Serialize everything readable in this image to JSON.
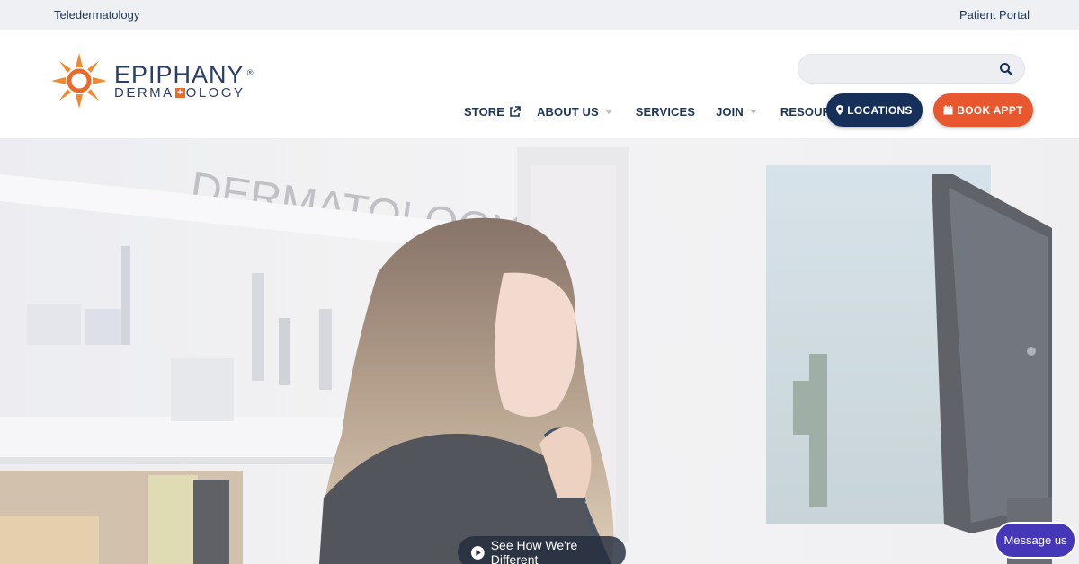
{
  "topbar": {
    "left_link": "Teledermatology",
    "right_link": "Patient Portal"
  },
  "logo": {
    "name": "EPIPHANY",
    "registered": "®",
    "sub_left": "DERMA",
    "sub_right": "OLOGY"
  },
  "search": {
    "placeholder": ""
  },
  "nav": {
    "items": [
      {
        "label": "STORE",
        "icon": "external-link-icon"
      },
      {
        "label": "ABOUT US",
        "dropdown": true
      },
      {
        "label": "SERVICES"
      },
      {
        "label": "JOIN",
        "dropdown": true
      },
      {
        "label": "RESOURCES",
        "dropdown": true
      }
    ],
    "locations_label": "LOCATIONS",
    "book_label": "BOOK APPT"
  },
  "hero": {
    "video_label": "See How We're Different"
  },
  "chat": {
    "label": "Message us"
  },
  "colors": {
    "navy": "#16305a",
    "orange": "#e9572f",
    "chat": "#4637b8"
  }
}
